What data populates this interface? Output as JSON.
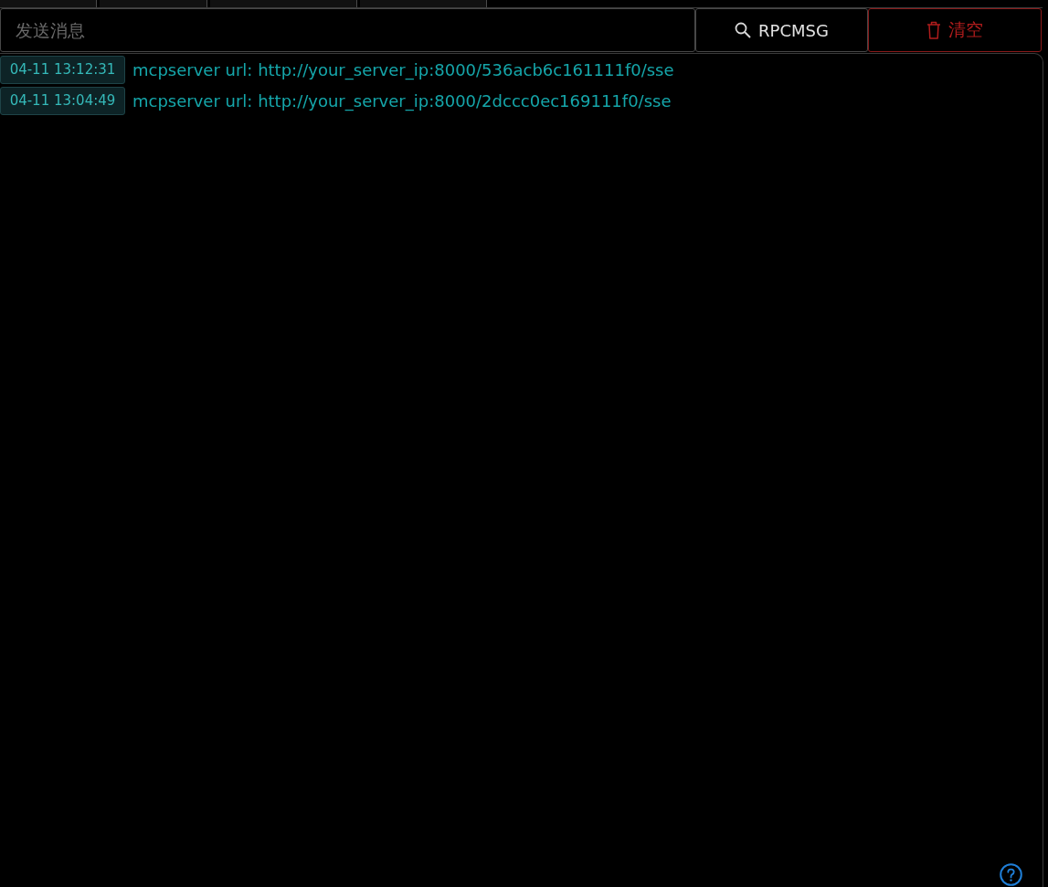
{
  "message_input": {
    "placeholder": "发送消息"
  },
  "buttons": [
    {
      "kind": "search",
      "label": "RPCMSG"
    },
    {
      "kind": "danger",
      "label": "清空"
    }
  ],
  "log": [
    {
      "time": "04-11 13:12:31",
      "text": "mcpserver url: http://your_server_ip:8000/536acb6c161111f0/sse"
    },
    {
      "time": "04-11 13:04:49",
      "text": "mcpserver url: http://your_server_ip:8000/2dccc0ec169111f0/sse"
    }
  ]
}
